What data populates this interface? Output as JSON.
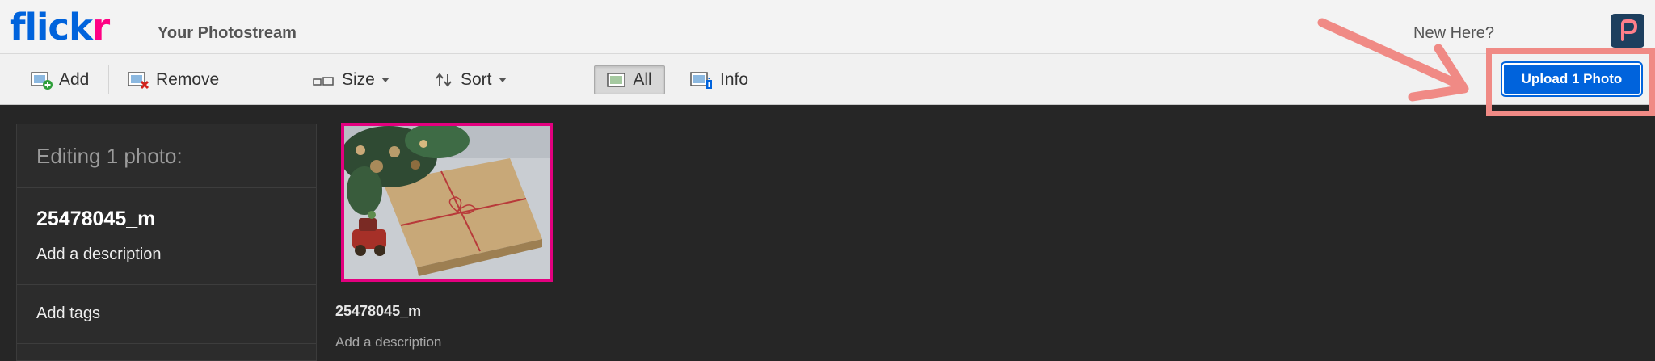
{
  "header": {
    "logo": {
      "part1": "flick",
      "part2": "r"
    },
    "title": "Your Photostream",
    "new_here": "New Here?",
    "app_icon": "p-icon"
  },
  "toolbar": {
    "add_label": "Add",
    "remove_label": "Remove",
    "size_label": "Size",
    "sort_label": "Sort",
    "all_label": "All",
    "info_label": "Info",
    "upload_label": "Upload 1 Photo"
  },
  "sidebar": {
    "heading": "Editing 1 photo:",
    "filename": "25478045_m",
    "description_placeholder": "Add a description",
    "tags_placeholder": "Add tags"
  },
  "photos": [
    {
      "name": "25478045_m",
      "description_placeholder": "Add a description",
      "selected": true
    }
  ],
  "colors": {
    "accent": "#0063dc",
    "brand_pink": "#ff0084",
    "selection": "#e3007f",
    "annotation": "#f08a85"
  }
}
